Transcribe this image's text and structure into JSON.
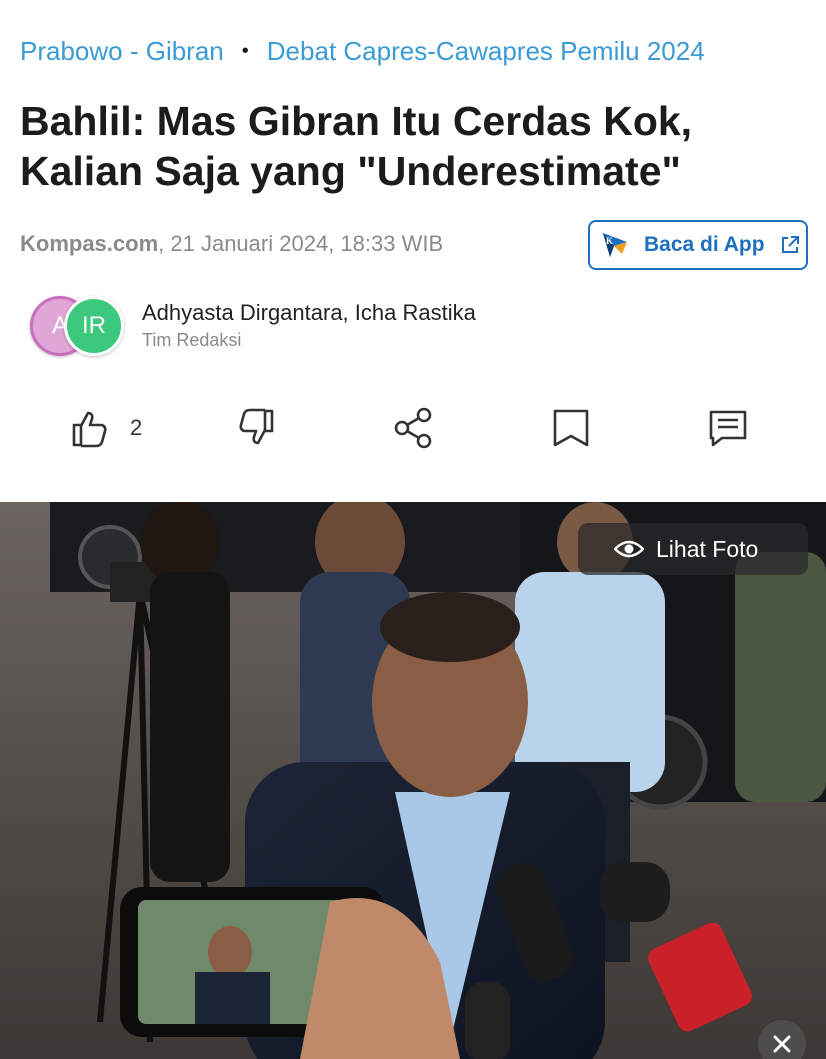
{
  "breadcrumb": {
    "items": [
      "Prabowo - Gibran",
      "Debat Capres-Cawapres Pemilu 2024"
    ],
    "separator": "•"
  },
  "article": {
    "title": "Bahlil: Mas Gibran Itu Cerdas Kok, Kalian Saja yang \"Underestimate\"",
    "source": "Kompas.com",
    "date": ", 21 Januari 2024, 18:33 WIB"
  },
  "app_button": {
    "label": "Baca di App",
    "logo_icon": "kompas-logo-icon",
    "external_icon": "external-link-icon"
  },
  "authors": {
    "avatars": [
      "A",
      "IR"
    ],
    "names": "Adhyasta Dirgantara,  Icha Rastika",
    "role": "Tim Redaksi"
  },
  "actions": {
    "like_count": "2",
    "icons": [
      "thumbs-up-icon",
      "thumbs-down-icon",
      "share-icon",
      "bookmark-icon",
      "comment-icon"
    ]
  },
  "photo": {
    "view_label": "Lihat Foto",
    "view_icon": "eye-icon",
    "close_icon": "close-icon"
  },
  "colors": {
    "link": "#3a9bd5",
    "app_button": "#1e6fbf",
    "meta_text": "#8a8a8a"
  }
}
